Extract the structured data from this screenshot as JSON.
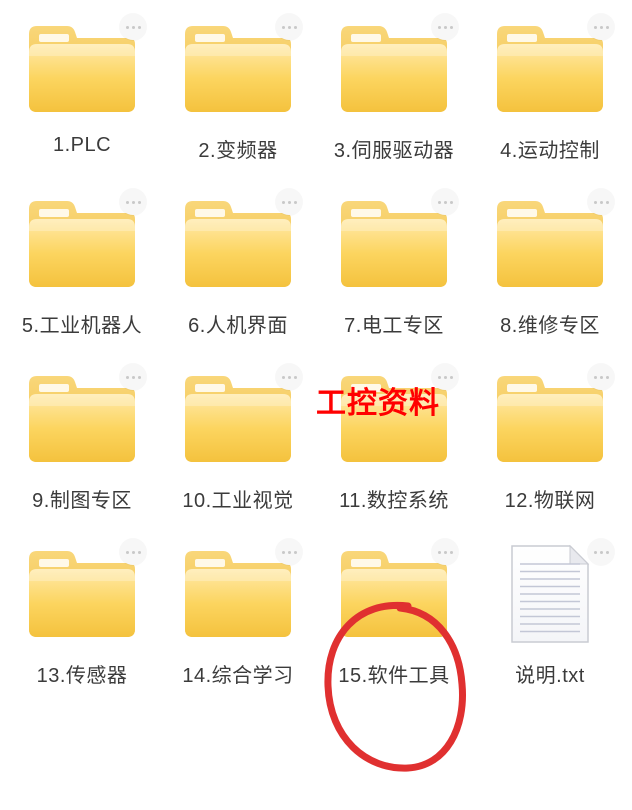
{
  "items": [
    {
      "label": "1.PLC",
      "type": "folder"
    },
    {
      "label": "2.变频器",
      "type": "folder"
    },
    {
      "label": "3.伺服驱动器",
      "type": "folder"
    },
    {
      "label": "4.运动控制",
      "type": "folder"
    },
    {
      "label": "5.工业机器人",
      "type": "folder"
    },
    {
      "label": "6.人机界面",
      "type": "folder"
    },
    {
      "label": "7.电工专区",
      "type": "folder"
    },
    {
      "label": "8.维修专区",
      "type": "folder"
    },
    {
      "label": "9.制图专区",
      "type": "folder"
    },
    {
      "label": "10.工业视觉",
      "type": "folder"
    },
    {
      "label": "11.数控系统",
      "type": "folder"
    },
    {
      "label": "12.物联网",
      "type": "folder"
    },
    {
      "label": "13.传感器",
      "type": "folder"
    },
    {
      "label": "14.综合学习",
      "type": "folder"
    },
    {
      "label": "15.软件工具",
      "type": "folder"
    },
    {
      "label": "说明.txt",
      "type": "txt"
    }
  ],
  "annotation": "工控资料"
}
